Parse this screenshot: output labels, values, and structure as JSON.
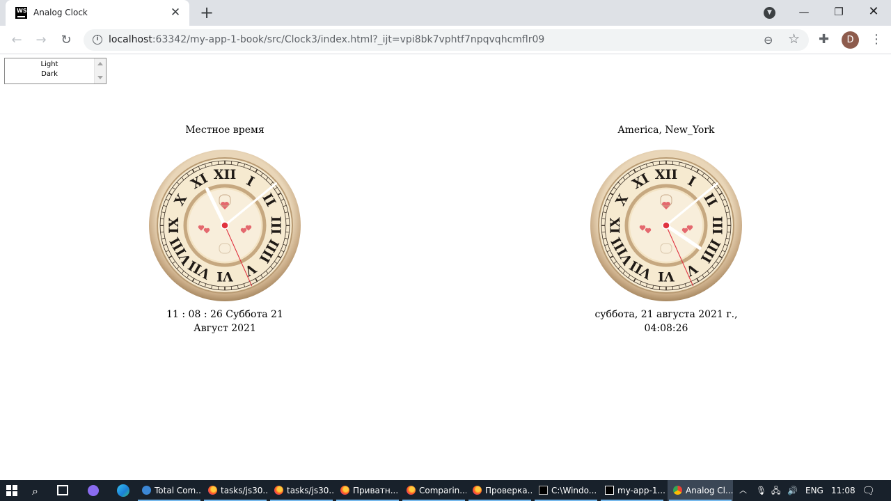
{
  "browser": {
    "tab_title": "Analog Clock",
    "tab_favicon_text": "WS",
    "tab_close": "✕",
    "new_tab": "+",
    "url_host": "localhost",
    "url_rest": ":63342/my-app-1-book/src/Clock3/index.html?_ijt=vpi8bk7vphtf7npqvqhcmflr09",
    "avatar_letter": "D",
    "icons": [
      "back-icon",
      "forward-icon",
      "reload-icon",
      "info-icon",
      "zoom-icon",
      "star-icon",
      "extensions-icon",
      "menu-icon"
    ]
  },
  "theme_select": {
    "options": [
      "Light",
      "Dark"
    ]
  },
  "clocks": [
    {
      "title": "Местное время",
      "time_text": "11 : 08 : 26 Суббота 21 Август 2021",
      "hours": 11,
      "minutes": 8,
      "seconds": 26
    },
    {
      "title": "America, New_York",
      "time_text": "суббота, 21 августа 2021 г., 04:08:26",
      "hours": 4,
      "minutes": 8,
      "seconds": 26
    }
  ],
  "taskbar": {
    "apps": [
      {
        "label": "Total Com...",
        "icon": "total-commander-icon"
      },
      {
        "label": "tasks/js30...",
        "icon": "firefox-icon"
      },
      {
        "label": "tasks/js30....",
        "icon": "firefox-icon"
      },
      {
        "label": "Приватн...",
        "icon": "firefox-icon"
      },
      {
        "label": "Comparin...",
        "icon": "firefox-icon"
      },
      {
        "label": "Проверка...",
        "icon": "firefox-icon"
      },
      {
        "label": "C:\\Windo...",
        "icon": "cmd-icon"
      },
      {
        "label": "my-app-1...",
        "icon": "webstorm-icon"
      },
      {
        "label": "Analog Cl...",
        "icon": "chrome-icon"
      }
    ],
    "tray_lang": "ENG",
    "tray_time": "11:08"
  },
  "colors": {
    "chrome_bg": "#dee1e6",
    "taskbar_bg": "#18212b",
    "clock_rim": "#c9ab86",
    "clock_dial": "#f6ead0",
    "second_hand": "#e0323f"
  }
}
